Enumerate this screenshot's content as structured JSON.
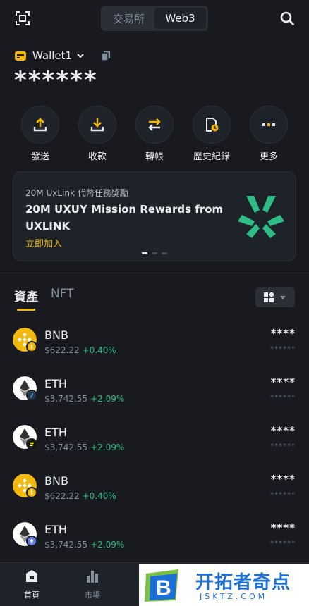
{
  "header": {
    "segments": [
      "交易所",
      "Web3"
    ],
    "active_segment": "Web3"
  },
  "wallet": {
    "name": "Wallet1",
    "balance": "******"
  },
  "actions": [
    {
      "label": "發送",
      "icon": "upload-icon"
    },
    {
      "label": "收款",
      "icon": "download-icon"
    },
    {
      "label": "轉帳",
      "icon": "swap-arrows-icon"
    },
    {
      "label": "歷史紀錄",
      "icon": "history-icon"
    },
    {
      "label": "更多",
      "icon": "more-dots-icon"
    }
  ],
  "banner": {
    "subtitle": "20M UxLink 代幣任務獎勵",
    "title": "20M UXUY Mission Rewards from UXLINK",
    "link": "立即加入",
    "accent": "#2ebd85",
    "slides": 3,
    "active_slide": 1
  },
  "tabs": [
    "資產",
    "NFT"
  ],
  "active_tab": "資產",
  "assets": [
    {
      "name": "BNB",
      "price": "$622.22",
      "change": "+0.40%",
      "amount": "****",
      "value": "******",
      "coin_color": "#f0b90b",
      "badge": "bnb-badge-icon"
    },
    {
      "name": "ETH",
      "price": "$3,742.55",
      "change": "+2.09%",
      "amount": "****",
      "value": "******",
      "coin_color": "#ffffff",
      "badge": "arbitrum-badge-icon"
    },
    {
      "name": "ETH",
      "price": "$3,742.55",
      "change": "+2.09%",
      "amount": "****",
      "value": "******",
      "coin_color": "#ffffff",
      "badge": "blast-badge-icon"
    },
    {
      "name": "BNB",
      "price": "$622.22",
      "change": "+0.40%",
      "amount": "****",
      "value": "******",
      "coin_color": "#f0b90b",
      "badge": "bnb-badge-icon"
    },
    {
      "name": "ETH",
      "price": "$3,742.55",
      "change": "+2.09%",
      "amount": "****",
      "value": "******",
      "coin_color": "#ffffff",
      "badge": "ethereum-badge-icon"
    }
  ],
  "bottom_nav": [
    {
      "label": "首頁",
      "icon": "home-icon"
    },
    {
      "label": "市場",
      "icon": "market-chart-icon"
    }
  ],
  "watermark": {
    "title": "开拓者奇点",
    "subtitle": "JSKTZ.COM"
  },
  "colors": {
    "background": "#181a20",
    "accent": "#f0b90b",
    "positive": "#2ebd85"
  }
}
